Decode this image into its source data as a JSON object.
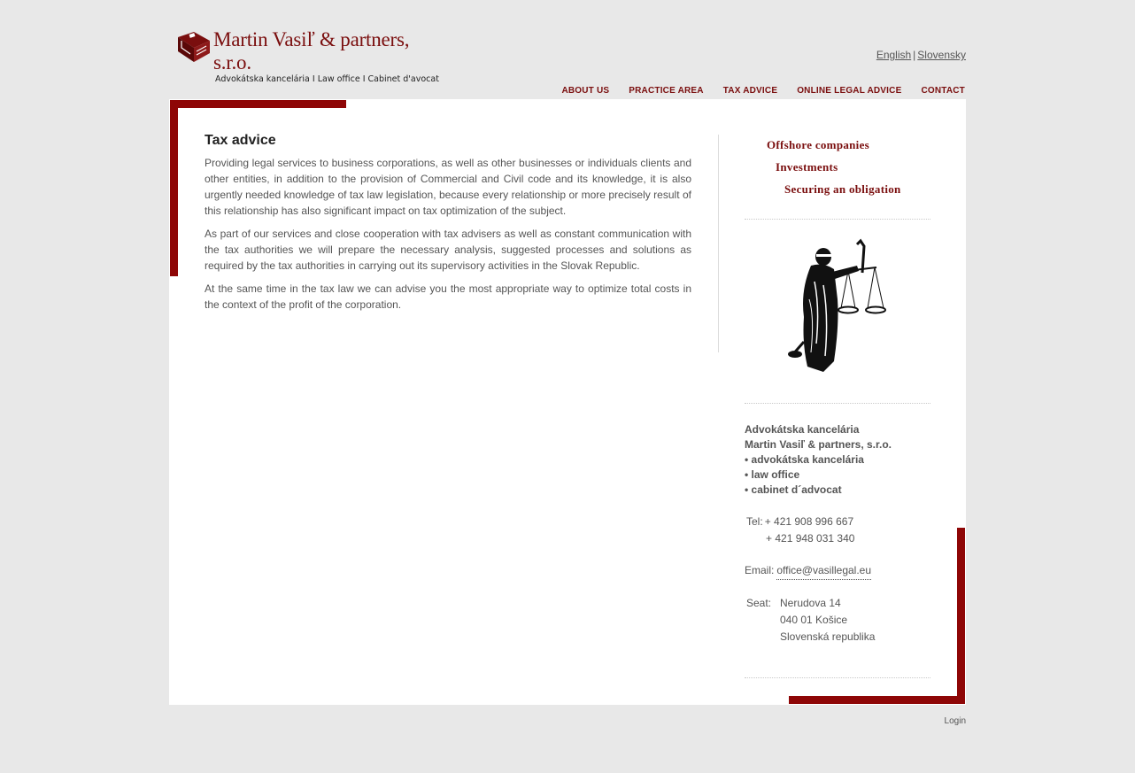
{
  "brand": {
    "title": "Martin Vasiľ & partners, s.r.o.",
    "subtitle": "Advokátska kancelária  I  Law office  I  Cabinet d'avocat",
    "accent_color": "#8e0606"
  },
  "languages": {
    "english": "English",
    "separator": "|",
    "slovak": "Slovensky"
  },
  "nav": {
    "items": [
      "ABOUT US",
      "PRACTICE AREA",
      "TAX ADVICE",
      "ONLINE LEGAL ADVICE",
      "CONTACT"
    ]
  },
  "content": {
    "heading": "Tax advice",
    "paragraphs": [
      "Providing legal services to business corporations, as well as other businesses or individuals clients and other entities, in addition to the provision of Commercial and Civil code and its knowledge, it is also urgently needed knowledge of tax law legislation, because every relationship or more precisely result of this relationship has also significant impact on tax optimization of the subject.",
      "As part of our services and close cooperation with tax advisers as well as constant communication with the tax authorities we will prepare the necessary analysis, suggested processes and solutions as required by the tax authorities in carrying out its supervisory activities in the Slovak Republic.",
      "At the same time in the tax law we can advise you the most appropriate way to optimize total costs in the context of the profit of the corporation."
    ]
  },
  "sidebar": {
    "links": [
      "Offshore companies",
      "Investments",
      "Securing an obligation"
    ],
    "image_icon": "lady-justice-icon",
    "address": {
      "lines_bold": [
        "Advokátska kancelária",
        "Martin Vasiľ & partners, s.r.o.",
        "• advokátska kancelária",
        "• law office",
        "• cabinet d´advocat"
      ],
      "tel_label": "Tel:",
      "tel1": "+ 421 908 996 667",
      "tel2": "+ 421 948 031 340",
      "email_label": "Email:",
      "email": "office@vasillegal.eu",
      "seat_label": "Seat:",
      "seat_lines": [
        "Nerudova 14",
        "040 01 Košice",
        "Slovenská republika"
      ]
    }
  },
  "footer": {
    "login": "Login"
  }
}
